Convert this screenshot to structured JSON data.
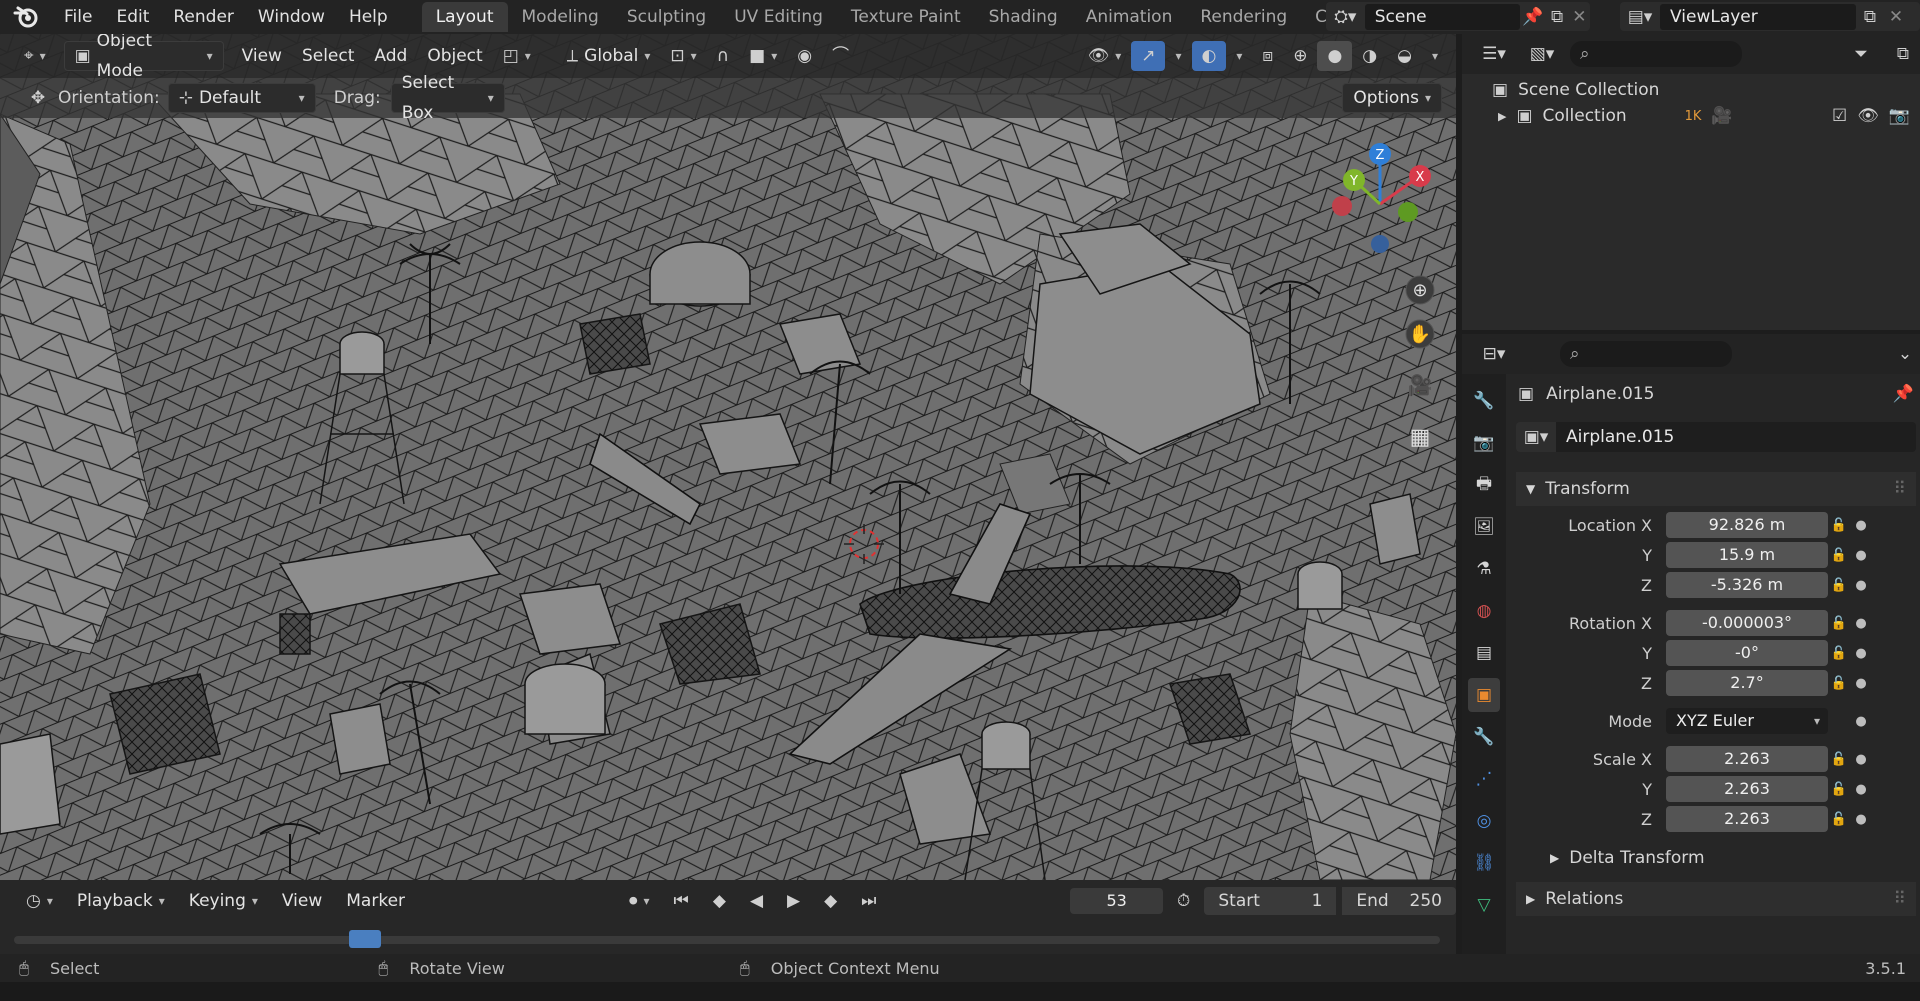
{
  "app": {
    "menus": [
      "File",
      "Edit",
      "Render",
      "Window",
      "Help"
    ],
    "workspaces": [
      "Layout",
      "Modeling",
      "Sculpting",
      "UV Editing",
      "Texture Paint",
      "Shading",
      "Animation",
      "Rendering",
      "Compo"
    ],
    "active_workspace": "Layout",
    "scene_name": "Scene",
    "view_layer": "ViewLayer"
  },
  "viewport": {
    "mode": "Object Mode",
    "menus": [
      "View",
      "Select",
      "Add",
      "Object"
    ],
    "transform_orientation": "Global",
    "tool_orientation_label": "Orientation:",
    "tool_orientation_value": "Default",
    "drag_label": "Drag:",
    "drag_value": "Select Box",
    "options_label": "Options",
    "gizmo_axes": [
      "X",
      "Y",
      "Z"
    ],
    "colors": {
      "x_axis": "#d83b4b",
      "y_axis": "#80b62a",
      "z_axis": "#2f7fd8",
      "selected_outline": "#ff7a1a"
    }
  },
  "outliner": {
    "root": "Scene Collection",
    "collection": "Collection",
    "collection_badge": "1K"
  },
  "properties": {
    "object_name": "Airplane.015",
    "data_name": "Airplane.015",
    "transform_header": "Transform",
    "location_label": "Location X",
    "location": [
      "92.826 m",
      "15.9 m",
      "-5.326 m"
    ],
    "rotation_label": "Rotation X",
    "rotation": [
      "-0.000003°",
      "-0°",
      "2.7°"
    ],
    "mode_label": "Mode",
    "rotation_mode": "XYZ Euler",
    "scale_label": "Scale X",
    "scale": [
      "2.263",
      "2.263",
      "2.263"
    ],
    "axis_y": "Y",
    "axis_z": "Z",
    "delta_header": "Delta Transform",
    "relations_header": "Relations"
  },
  "timeline": {
    "menus": [
      "Playback",
      "Keying",
      "View",
      "Marker"
    ],
    "current_frame": "53",
    "start_label": "Start",
    "start": "1",
    "end_label": "End",
    "end": "250"
  },
  "status": {
    "select": "Select",
    "rotate": "Rotate View",
    "context": "Object Context Menu",
    "version": "3.5.1"
  }
}
